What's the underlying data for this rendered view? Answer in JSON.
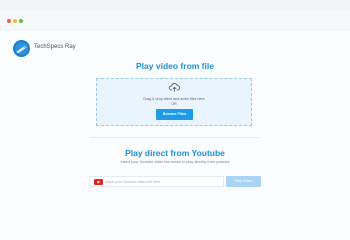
{
  "app": {
    "brand_name": "TechSpecs Ray",
    "logo_icon": "ray-logo-icon",
    "accent_color": "#1e8fd8",
    "button_color": "#1c9be7"
  },
  "window_controls": [
    "close",
    "minimize",
    "maximize"
  ],
  "file_section": {
    "title": "Play video from file",
    "drop_instructions": "Drag & drop video and audio files here",
    "or_text": "OR",
    "browse_button_label": "Browse Files",
    "upload_icon": "cloud-upload-icon"
  },
  "youtube_section": {
    "title": "Play direct from Youtube",
    "subtitle": "Insert your Youtube video link below to play directly from youtube",
    "input_placeholder": "Insert your Youtube video link here",
    "input_value": "",
    "youtube_icon": "youtube-icon",
    "play_button_label": "Play Video"
  }
}
